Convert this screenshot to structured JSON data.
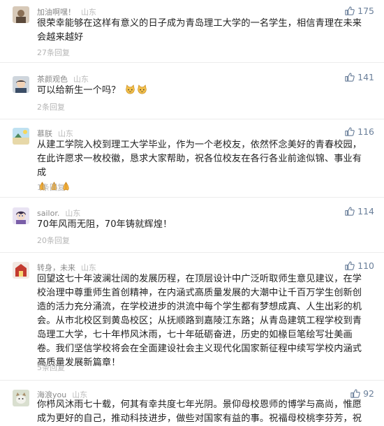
{
  "comments": [
    {
      "user": "加油啊嘿！",
      "location": "山东",
      "likes": "175",
      "text": "很荣幸能够在这样有意义的日子成为青岛理工大学的一名学生，相信青理在未来会越来越好",
      "replies": "27条回复"
    },
    {
      "user": "茶颜观色",
      "location": "山东",
      "likes": "141",
      "text": "可以给新生一个吗？",
      "emoji": [
        "cat-emoji",
        "cat-emoji"
      ],
      "replies": "2条回复"
    },
    {
      "user": "慕朕",
      "location": "山东",
      "likes": "116",
      "text": "从建工学院入校到理工大学毕业，作为一个老校友，依然怀念美好的青春校园，在此许愿求一枚校徽，恳求大家帮助，祝各位校友在各行各业前途似锦、事业有成",
      "emoji": [
        "pray-emoji",
        "pray-emoji",
        "pray-emoji"
      ],
      "replies": "1条回复"
    },
    {
      "user": "sailor.",
      "location": "山东",
      "likes": "114",
      "text": "70年风雨无阻，70年铸就辉煌！",
      "replies": "20条回复"
    },
    {
      "user": "转身，未来",
      "location": "山东",
      "likes": "110",
      "text": "回望这七十年波澜壮阔的发展历程，在顶层设计中广泛听取师生意见建议，在学校治理中尊重师生首创精神，在内涵式高质量发展的大潮中让千百万学生创新创造的活力充分涌流，在学校进步的洪流中每个学生都有梦想成真、人生出彩的机会。从市北校区到黄岛校区；从抚顺路到嘉陵江东路；从青岛建筑工程学校到青岛理工大学，七十年栉风沐雨，七十年砥砺奋进，历史的如椽巨笔绘写壮美画卷。我们坚信学校将会在全面建设社会主义现代化国家新征程中续写学校内涵式高质量发展新篇章！",
      "replies": "5条回复"
    },
    {
      "user": "海浪you",
      "location": "山东",
      "likes": "92",
      "text": "你栉风沐雨七十载，何其有幸共度七年光阴。景仰母校恩师的博学与高尚，惟愿成为更好的自己，推动科技进步，做些对国家有益的事。祝福母校桃李芬芳，祝福校"
    }
  ],
  "colors": {
    "like": "#6a7f9a",
    "meta": "#999999",
    "text": "#222222",
    "divider": "#ececec"
  }
}
